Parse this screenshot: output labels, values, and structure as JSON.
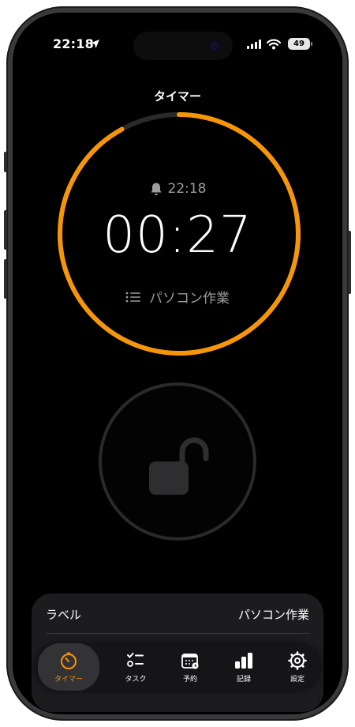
{
  "status_bar": {
    "time": "22:18",
    "battery": "49"
  },
  "header": {
    "title": "タイマー"
  },
  "timer": {
    "alarm_time": "22:18",
    "countdown": "00:27",
    "task_name": "パソコン作業",
    "progress": 0.92
  },
  "sheet": {
    "label_key": "ラベル",
    "label_value": "パソコン作業"
  },
  "tabs": [
    {
      "label": "タイマー",
      "icon": "timer-icon",
      "active": true
    },
    {
      "label": "タスク",
      "icon": "checklist-icon",
      "active": false
    },
    {
      "label": "予約",
      "icon": "calendar-icon",
      "active": false
    },
    {
      "label": "記録",
      "icon": "bar-chart-icon",
      "active": false
    },
    {
      "label": "設定",
      "icon": "gear-icon",
      "active": false
    }
  ],
  "colors": {
    "accent": "#f5950a",
    "ring_track": "#2a2a2a",
    "background": "#000000"
  }
}
